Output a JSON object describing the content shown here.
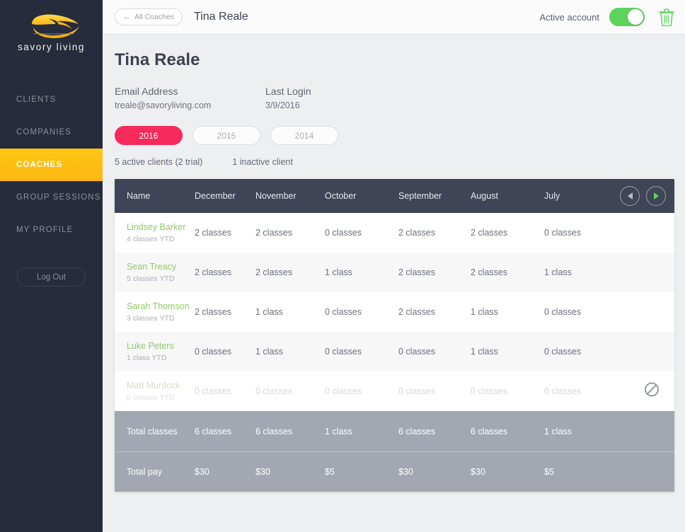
{
  "sidebar": {
    "logo_text": "savory living",
    "logo_icon": "leaf-swirl-logo",
    "items": [
      {
        "label": "CLIENTS",
        "active": false
      },
      {
        "label": "COMPANIES",
        "active": false
      },
      {
        "label": "COACHES",
        "active": true
      },
      {
        "label": "GROUP SESSIONS",
        "active": false
      },
      {
        "label": "MY PROFILE",
        "active": false
      }
    ],
    "logout_label": "Log Out"
  },
  "topbar": {
    "back_label": "All Coaches",
    "back_icon": "arrow-left-icon",
    "title": "Tina Reale",
    "active_account_label": "Active account",
    "toggle_on": true,
    "delete_icon": "trash-icon"
  },
  "profile": {
    "name": "Tina Reale",
    "email_label": "Email Address",
    "email_value": "treale@savoryliving.com",
    "last_login_label": "Last Login",
    "last_login_value": "3/9/2016"
  },
  "years": [
    {
      "label": "2016",
      "selected": true
    },
    {
      "label": "2015",
      "selected": false
    },
    {
      "label": "2014",
      "selected": false
    }
  ],
  "counts": {
    "active": "5 active clients (2 trial)",
    "inactive": "1 inactive client"
  },
  "table": {
    "columns": [
      "Name",
      "December",
      "November",
      "October",
      "September",
      "August",
      "July"
    ],
    "prev_icon": "chevron-left-icon",
    "next_icon": "chevron-right-icon",
    "rows": [
      {
        "name": "Lindsey Barker",
        "sub": "4 classes YTD",
        "values": [
          "2 classes",
          "2 classes",
          "0 classes",
          "2 classes",
          "2 classes",
          "0 classes"
        ],
        "disabled": false
      },
      {
        "name": "Sean Treacy",
        "sub": "5 classes YTD",
        "values": [
          "2 classes",
          "2 classes",
          "1 class",
          "2 classes",
          "2 classes",
          "1 class"
        ],
        "disabled": false
      },
      {
        "name": "Sarah Thomson",
        "sub": "3 classes YTD",
        "values": [
          "2 classes",
          "1 class",
          "0 classes",
          "2 classes",
          "1 class",
          "0 classes"
        ],
        "disabled": false
      },
      {
        "name": "Luke Peters",
        "sub": "1 class YTD",
        "values": [
          "0 classes",
          "1 class",
          "0 classes",
          "0 classes",
          "1 class",
          "0 classes"
        ],
        "disabled": false
      },
      {
        "name": "Matt Murdock",
        "sub": "0 classes YTD",
        "values": [
          "0 classes",
          "0 classes",
          "0 classes",
          "0 classes",
          "0 classes",
          "0 classes"
        ],
        "disabled": true,
        "status_icon": "no-entry-icon"
      }
    ],
    "totals": [
      {
        "label": "Total classes",
        "values": [
          "6 classes",
          "6 classes",
          "1 class",
          "6 classes",
          "6 classes",
          "1 class"
        ]
      },
      {
        "label": "Total pay",
        "values": [
          "$30",
          "$30",
          "$5",
          "$30",
          "$30",
          "$5"
        ]
      }
    ]
  },
  "colors": {
    "sidebar_bg": "#262c3b",
    "accent_yellow": "#ffc712",
    "accent_pink": "#f72a5d",
    "accent_green": "#5ed45c",
    "name_green": "#90c96a",
    "table_header": "#3f4557",
    "totals_bg": "#a2a7b2",
    "page_bg": "#eeeff0"
  }
}
